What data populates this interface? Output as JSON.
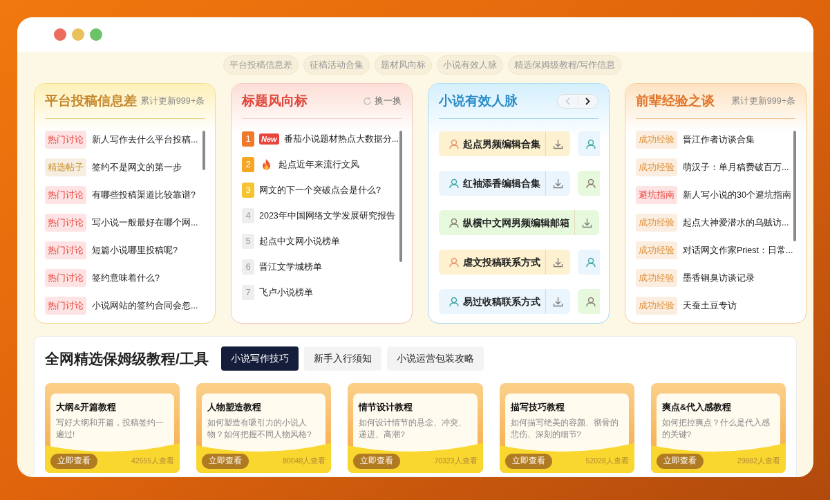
{
  "nav_pills": [
    {
      "label": "平台投稿信息差"
    },
    {
      "label": "征稿活动合集"
    },
    {
      "label": "题材风向标"
    },
    {
      "label": "小说有效人脉"
    },
    {
      "label": "精选保姆级教程/写作信息"
    }
  ],
  "platform_panel": {
    "title": "平台投稿信息差",
    "meta": "累计更新999+条",
    "items": [
      {
        "tag": "热门讨论",
        "kind": "hot",
        "text": "新人写作去什么平台投稿..."
      },
      {
        "tag": "精选帖子",
        "kind": "featured",
        "text": "签约不是网文的第一步"
      },
      {
        "tag": "热门讨论",
        "kind": "hot",
        "text": "有哪些投稿渠道比较靠谱?"
      },
      {
        "tag": "热门讨论",
        "kind": "hot",
        "text": "写小说一般最好在哪个网..."
      },
      {
        "tag": "热门讨论",
        "kind": "hot",
        "text": "短篇小说哪里投稿呢?"
      },
      {
        "tag": "热门讨论",
        "kind": "hot",
        "text": "签约意味着什么?"
      },
      {
        "tag": "热门讨论",
        "kind": "hot",
        "text": "小说网站的签约合同会忽..."
      }
    ]
  },
  "trend_panel": {
    "title": "标题风向标",
    "refresh": "换一换",
    "items": [
      {
        "rank": "1",
        "color": "#f07a2c",
        "kind": "new",
        "badge": "New",
        "text": "番茄小说题材热点大数据分..."
      },
      {
        "rank": "2",
        "color": "#f5a623",
        "kind": "hot",
        "text": "起点近年来流行文风"
      },
      {
        "rank": "3",
        "color": "#f7c331",
        "kind": "plain",
        "text": "网文的下一个突破点会是什么?"
      },
      {
        "rank": "4",
        "color": "#eeeeee",
        "kind": "plain",
        "text": "2023年中国网络文学发展研究报告"
      },
      {
        "rank": "5",
        "color": "#eeeeee",
        "kind": "plain",
        "text": "起点中文网小说榜单"
      },
      {
        "rank": "6",
        "color": "#eeeeee",
        "kind": "plain",
        "text": "晋江文学城榜单"
      },
      {
        "rank": "7",
        "color": "#eeeeee",
        "kind": "plain",
        "text": "飞卢小说榜单"
      }
    ]
  },
  "contacts_panel": {
    "title": "小说有效人脉",
    "prev_disabled": true,
    "items": [
      {
        "label": "起点男频编辑合集",
        "color": "#fdf1cf",
        "peek": {
          "color": "#eaf5fd"
        }
      },
      {
        "label": "红袖添香编辑合集",
        "color": "#eaf5fd",
        "peek": {
          "color": "#e6f9dc"
        }
      },
      {
        "label": "纵横中文网男频编辑邮箱",
        "color": "#e6f9dc"
      },
      {
        "label": "虐文投稿联系方式",
        "color": "#fdf1cf",
        "peek": {
          "color": "#eaf5fd"
        }
      },
      {
        "label": "易过收稿联系方式",
        "color": "#eaf5fd",
        "peek": {
          "color": "#e6f9dc"
        }
      }
    ]
  },
  "experience_panel": {
    "title": "前辈经验之谈",
    "meta": "累计更新999+条",
    "items": [
      {
        "tag": "成功经验",
        "kind": "success",
        "text": "晋江作者访谈合集"
      },
      {
        "tag": "成功经验",
        "kind": "success",
        "text": "萌汉子：单月稿费破百万..."
      },
      {
        "tag": "避坑指南",
        "kind": "pitfall",
        "text": "新人写小说的30个避坑指南"
      },
      {
        "tag": "成功经验",
        "kind": "success",
        "text": "起点大神爱潜水的乌贼访..."
      },
      {
        "tag": "成功经验",
        "kind": "success",
        "text": "对话网文作家Priest：日常..."
      },
      {
        "tag": "成功经验",
        "kind": "success",
        "text": "墨香铜臭访谈记录"
      },
      {
        "tag": "成功经验",
        "kind": "success",
        "text": "天蚕土豆专访"
      }
    ]
  },
  "tutorials": {
    "title": "全网精选保姆级教程/工具",
    "tabs": [
      {
        "label": "小说写作技巧",
        "selected": true
      },
      {
        "label": "新手入行须知",
        "selected": false
      },
      {
        "label": "小说运营包装攻略",
        "selected": false
      }
    ],
    "cards": [
      {
        "title": "大纲&开篇教程",
        "desc": "写好大纲和开篇，投稿签约一遍过!",
        "button": "立即查看",
        "views": "42555人查看"
      },
      {
        "title": "人物塑造教程",
        "desc": "如何塑造有吸引力的小说人物？如何把握不同人物风格?",
        "button": "立即查看",
        "views": "80048人查看"
      },
      {
        "title": "情节设计教程",
        "desc": "如何设计情节的悬念、冲突、递进、高潮?",
        "button": "立即查看",
        "views": "70323人查看"
      },
      {
        "title": "描写技巧教程",
        "desc": "如何描写绝美的容颜、彻骨的悲伤、深刻的细节?",
        "button": "立即查看",
        "views": "52028人查看"
      },
      {
        "title": "爽点&代入感教程",
        "desc": "如何把控爽点？什么是代入感的关键?",
        "button": "立即查看",
        "views": "29882人查看"
      }
    ]
  }
}
